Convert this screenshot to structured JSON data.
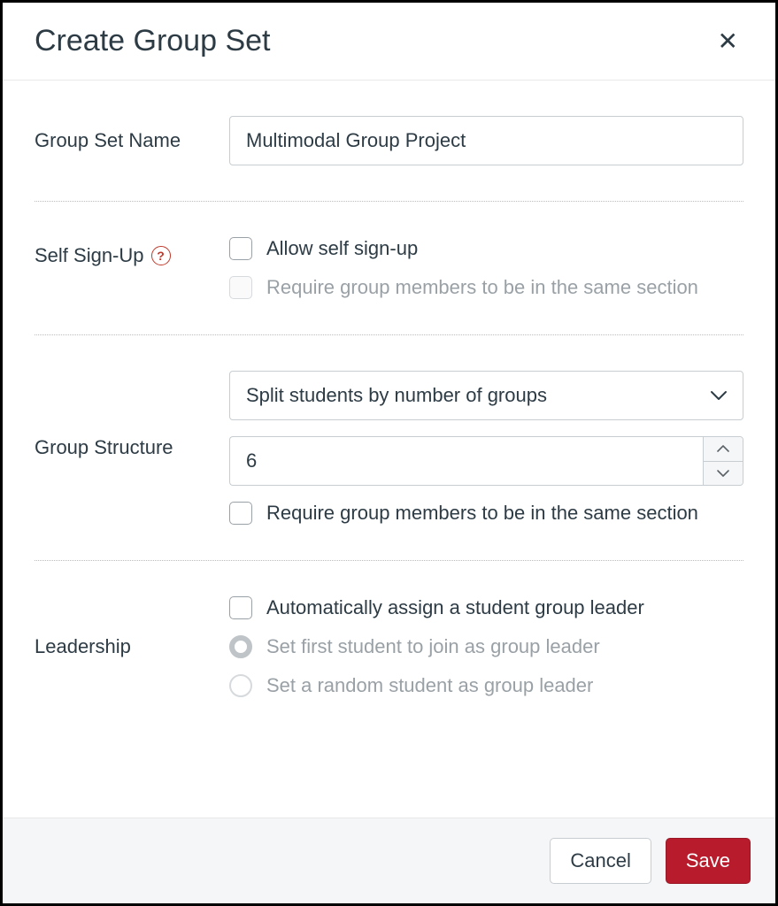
{
  "header": {
    "title": "Create Group Set"
  },
  "groupName": {
    "label": "Group Set Name",
    "value": "Multimodal Group Project"
  },
  "selfSignUp": {
    "label": "Self Sign-Up",
    "allowLabel": "Allow self sign-up",
    "sameSectionLabel": "Require group members to be in the same section"
  },
  "groupStructure": {
    "label": "Group Structure",
    "splitSelected": "Split students by number of groups",
    "countValue": "6",
    "sameSectionLabel": "Require group members to be in the same section"
  },
  "leadership": {
    "label": "Leadership",
    "autoAssignLabel": "Automatically assign a student group leader",
    "firstJoinLabel": "Set first student to join as group leader",
    "randomLabel": "Set a random student as group leader"
  },
  "footer": {
    "cancel": "Cancel",
    "save": "Save"
  }
}
